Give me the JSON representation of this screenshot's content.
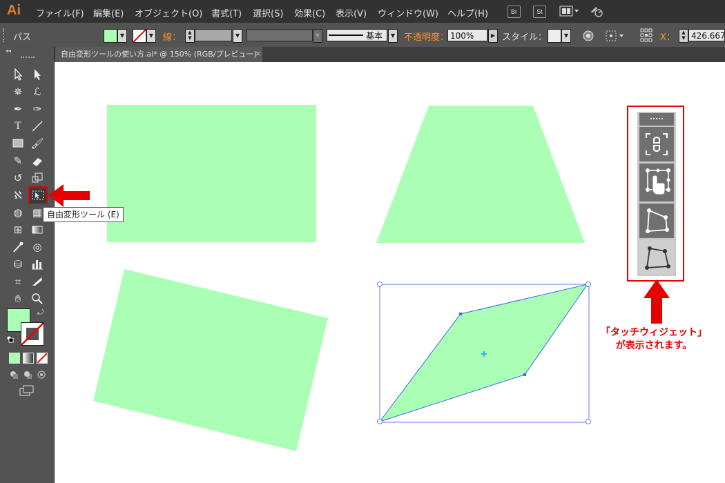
{
  "app": {
    "logo": "Ai"
  },
  "menu": {
    "items": [
      "ファイル(F)",
      "編集(E)",
      "オブジェクト(O)",
      "書式(T)",
      "選択(S)",
      "効果(C)",
      "表示(V)",
      "ウィンドウ(W)",
      "ヘルプ(H)"
    ],
    "bridge_label": "Br",
    "stock_label": "St"
  },
  "control_bar": {
    "selection_label": "パス",
    "stroke_label": "線：",
    "stroke_style_label": "基本",
    "opacity_label": "不透明度：",
    "opacity_value": "100%",
    "style_label": "スタイル：",
    "x_label": "X：",
    "x_value": "426.667"
  },
  "document": {
    "tab_title": "自由変形ツールの使い方.ai* @ 150% (RGB/プレビュー)",
    "close_glyph": "×"
  },
  "tooltip": {
    "text": "自由変形ツール (E)"
  },
  "annotation": {
    "line1": "「タッチウィジェット」",
    "line2": "が表示されます。"
  },
  "colors": {
    "shape_fill": "#aaffb5",
    "accent": "#e60000",
    "selection": "#3366ff"
  }
}
